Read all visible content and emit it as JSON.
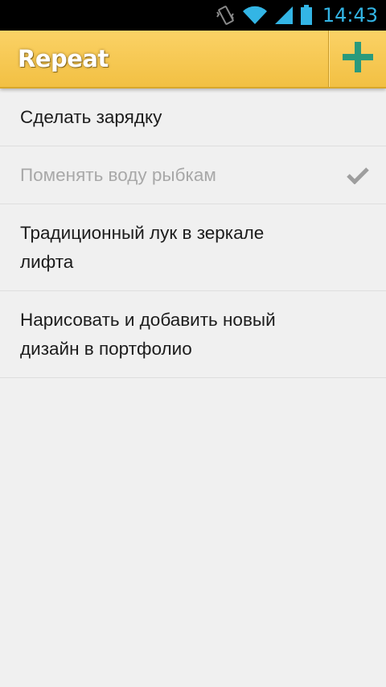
{
  "status_bar": {
    "time": "14:43",
    "icons": [
      "vibrate-icon",
      "wifi-icon",
      "signal-icon",
      "battery-icon"
    ],
    "time_color": "#33b5e5"
  },
  "action_bar": {
    "title": "Repeat",
    "add_icon": "plus-icon",
    "background": "#f6c84f",
    "accent": "#2a9a7c"
  },
  "tasks": [
    {
      "text": "Сделать зарядку",
      "done": false
    },
    {
      "text": "Поменять воду рыбкам",
      "done": true,
      "icon": "check-icon"
    },
    {
      "text": "Традиционный лук в зеркале лифта",
      "done": false
    },
    {
      "text": "Нарисовать и добавить новый дизайн в портфолио",
      "done": false
    }
  ]
}
